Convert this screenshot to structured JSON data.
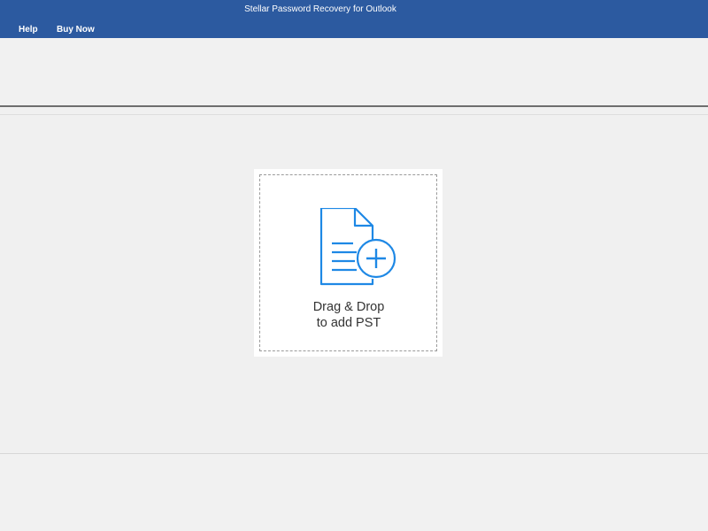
{
  "window": {
    "title": "Stellar Password Recovery for Outlook"
  },
  "menu": {
    "items": [
      {
        "label": "Help"
      },
      {
        "label": "Buy Now"
      }
    ]
  },
  "dropzone": {
    "line1": "Drag & Drop",
    "line2": "to add PST",
    "icon": "add-file-icon"
  },
  "colors": {
    "titlebar": "#2c5aa0",
    "accent": "#1e88e5",
    "background": "#f0f0f0"
  }
}
